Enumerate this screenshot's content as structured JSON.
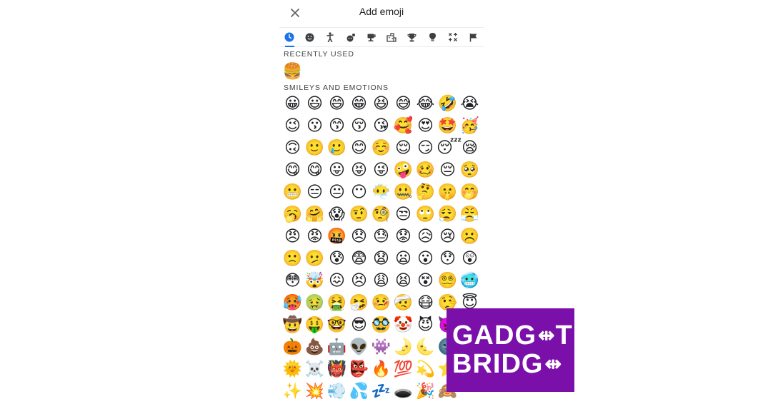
{
  "dialog": {
    "title": "Add emoji",
    "close_icon": "close-icon"
  },
  "colors": {
    "accent": "#1a73e8",
    "watermark_bg": "#7a10a9"
  },
  "tabs": [
    {
      "icon": "clock-icon",
      "active": true
    },
    {
      "icon": "smiley-icon",
      "active": false
    },
    {
      "icon": "person-icon",
      "active": false
    },
    {
      "icon": "animals-icon",
      "active": false
    },
    {
      "icon": "food-icon",
      "active": false
    },
    {
      "icon": "travel-icon",
      "active": false
    },
    {
      "icon": "trophy-icon",
      "active": false
    },
    {
      "icon": "lightbulb-icon",
      "active": false
    },
    {
      "icon": "symbols-icon",
      "active": false
    },
    {
      "icon": "flag-icon",
      "active": false
    }
  ],
  "sections": {
    "recent": {
      "label": "RECENTLY USED",
      "emojis": [
        "🍔"
      ]
    },
    "smileys": {
      "label": "SMILEYS AND EMOTIONS",
      "emojis": [
        "😀",
        "😃",
        "😄",
        "😁",
        "😆",
        "😅",
        "😂",
        "🤣",
        "😭",
        "😉",
        "😗",
        "😙",
        "😚",
        "😘",
        "🥰",
        "😍",
        "🤩",
        "🥳",
        "🙃",
        "🙂",
        "🥲",
        "😊",
        "☺️",
        "😌",
        "😏",
        "😴",
        "😪",
        "😋",
        "😋",
        "😛",
        "😝",
        "😜",
        "🤪",
        "🥴",
        "😔",
        "🥺",
        "😬",
        "😑",
        "😐",
        "😶",
        "😶‍🌫️",
        "🤐",
        "🤔",
        "🤫",
        "🤭",
        "🥱",
        "🤗",
        "😱",
        "🤨",
        "🧐",
        "😒",
        "🙄",
        "😮‍💨",
        "😤",
        "😠",
        "😡",
        "🤬",
        "😞",
        "😓",
        "😟",
        "😥",
        "😢",
        "☹️",
        "🙁",
        "🫤",
        "😰",
        "😨",
        "😧",
        "😦",
        "😮",
        "😯",
        "😲",
        "😳",
        "🤯",
        "😖",
        "😣",
        "😩",
        "😫",
        "😵",
        "😵‍💫",
        "🥶",
        "🥵",
        "🤢",
        "🤮",
        "🤧",
        "🤒",
        "🤕",
        "😷",
        "🤥",
        "😇",
        "🤠",
        "🤑",
        "🤓",
        "😎",
        "🥸",
        "🤡",
        "😈",
        "👿",
        "",
        "🎃",
        "💩",
        "🤖",
        "👽",
        "👾",
        "🌛",
        "🌜",
        "🌚",
        "",
        "🌞",
        "☠️",
        "👹",
        "👺",
        "🔥",
        "💯",
        "💫",
        "⭐",
        "",
        "✨",
        "💥",
        "💨",
        "💦",
        "💤",
        "🕳️",
        "🎉",
        "🙈",
        ""
      ]
    }
  },
  "watermark": {
    "line1": "GADG",
    "line1b": "T",
    "line2": "BRIDG",
    "mark": "⇹"
  }
}
